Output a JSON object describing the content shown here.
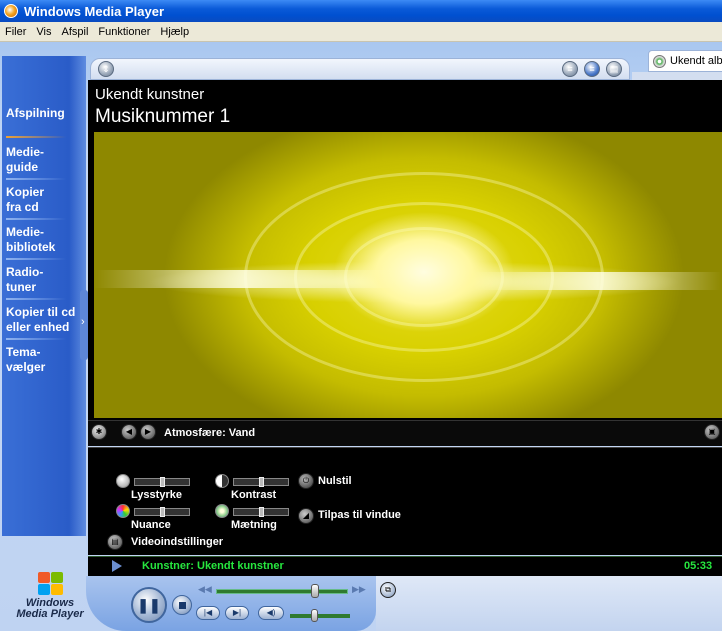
{
  "window": {
    "title": "Windows Media Player"
  },
  "menu": [
    "Filer",
    "Vis",
    "Afspil",
    "Funktioner",
    "Hjælp"
  ],
  "taskbar": {
    "items": [
      {
        "label_line1": "Afspilning",
        "label_line2": ""
      },
      {
        "label_line1": "Medie-",
        "label_line2": "guide"
      },
      {
        "label_line1": "Kopier",
        "label_line2": "fra cd"
      },
      {
        "label_line1": "Medie-",
        "label_line2": "bibliotek"
      },
      {
        "label_line1": "Radio-",
        "label_line2": "tuner"
      },
      {
        "label_line1": "Kopier til cd",
        "label_line2": "eller enhed"
      },
      {
        "label_line1": "Tema-",
        "label_line2": "vælger"
      }
    ]
  },
  "playlist_tab": {
    "label": "Ukendt alb"
  },
  "now_playing": {
    "artist": "Ukendt kunstner",
    "track": "Musiknummer 1"
  },
  "visualization": {
    "name": "Atmosfære: Vand"
  },
  "enhancements": {
    "brightness": "Lysstyrke",
    "contrast": "Kontrast",
    "reset": "Nulstil",
    "hue": "Nuance",
    "saturation": "Mætning",
    "fit_to_window": "Tilpas til vindue",
    "video_settings": "Videoindstillinger"
  },
  "status": {
    "text": "Kunstner: Ukendt kunstner",
    "time": "05:33"
  },
  "logo": {
    "line1": "Windows",
    "line2": "Media Player"
  },
  "playback": {
    "seek_position": 0.75,
    "volume": 0.4
  },
  "colors": {
    "status_green": "#27e63f",
    "skin_blue": "#2a5cc8",
    "visual_yellow": "#d8d000"
  }
}
